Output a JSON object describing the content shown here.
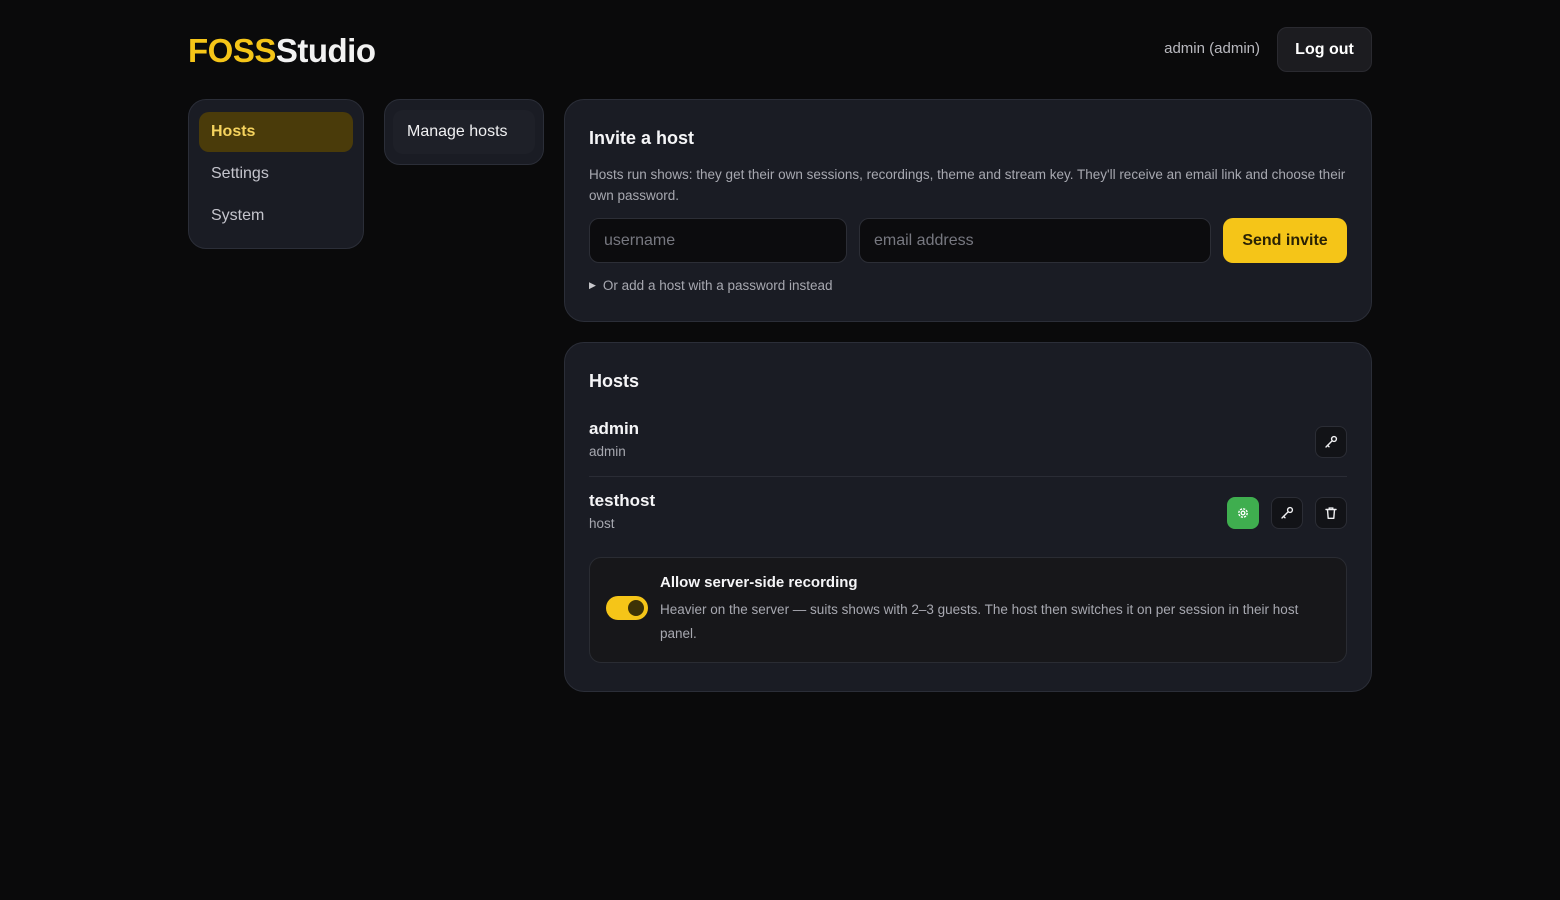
{
  "header": {
    "logo_part1": "FOSS",
    "logo_part2": "Studio",
    "user_label": "admin (admin)",
    "logout_label": "Log out"
  },
  "nav": {
    "items": [
      {
        "label": "Hosts",
        "active": true
      },
      {
        "label": "Settings",
        "active": false
      },
      {
        "label": "System",
        "active": false
      }
    ]
  },
  "subnav": {
    "items": [
      {
        "label": "Manage hosts"
      }
    ]
  },
  "invite": {
    "title": "Invite a host",
    "description": "Hosts run shows: they get their own sessions, recordings, theme and stream key. They'll receive an email link and choose their own password.",
    "username_placeholder": "username",
    "email_placeholder": "email address",
    "send_label": "Send invite",
    "password_toggle_label": "Or add a host with a password instead"
  },
  "hosts": {
    "title": "Hosts",
    "rows": [
      {
        "name": "admin",
        "role": "admin"
      },
      {
        "name": "testhost",
        "role": "host"
      }
    ],
    "recording": {
      "title": "Allow server-side recording",
      "description": "Heavier on the server — suits shows with 2–3 guests. The host then switches it on per session in their host panel.",
      "enabled": true
    }
  },
  "colors": {
    "accent": "#f5c518",
    "settings_button": "#3fae4f",
    "background": "#0a0a0b",
    "card": "#1a1c24"
  },
  "icons": {
    "key": "key-icon",
    "gear": "gear-icon",
    "trash": "trash-icon",
    "caret": "caret-right-icon"
  }
}
